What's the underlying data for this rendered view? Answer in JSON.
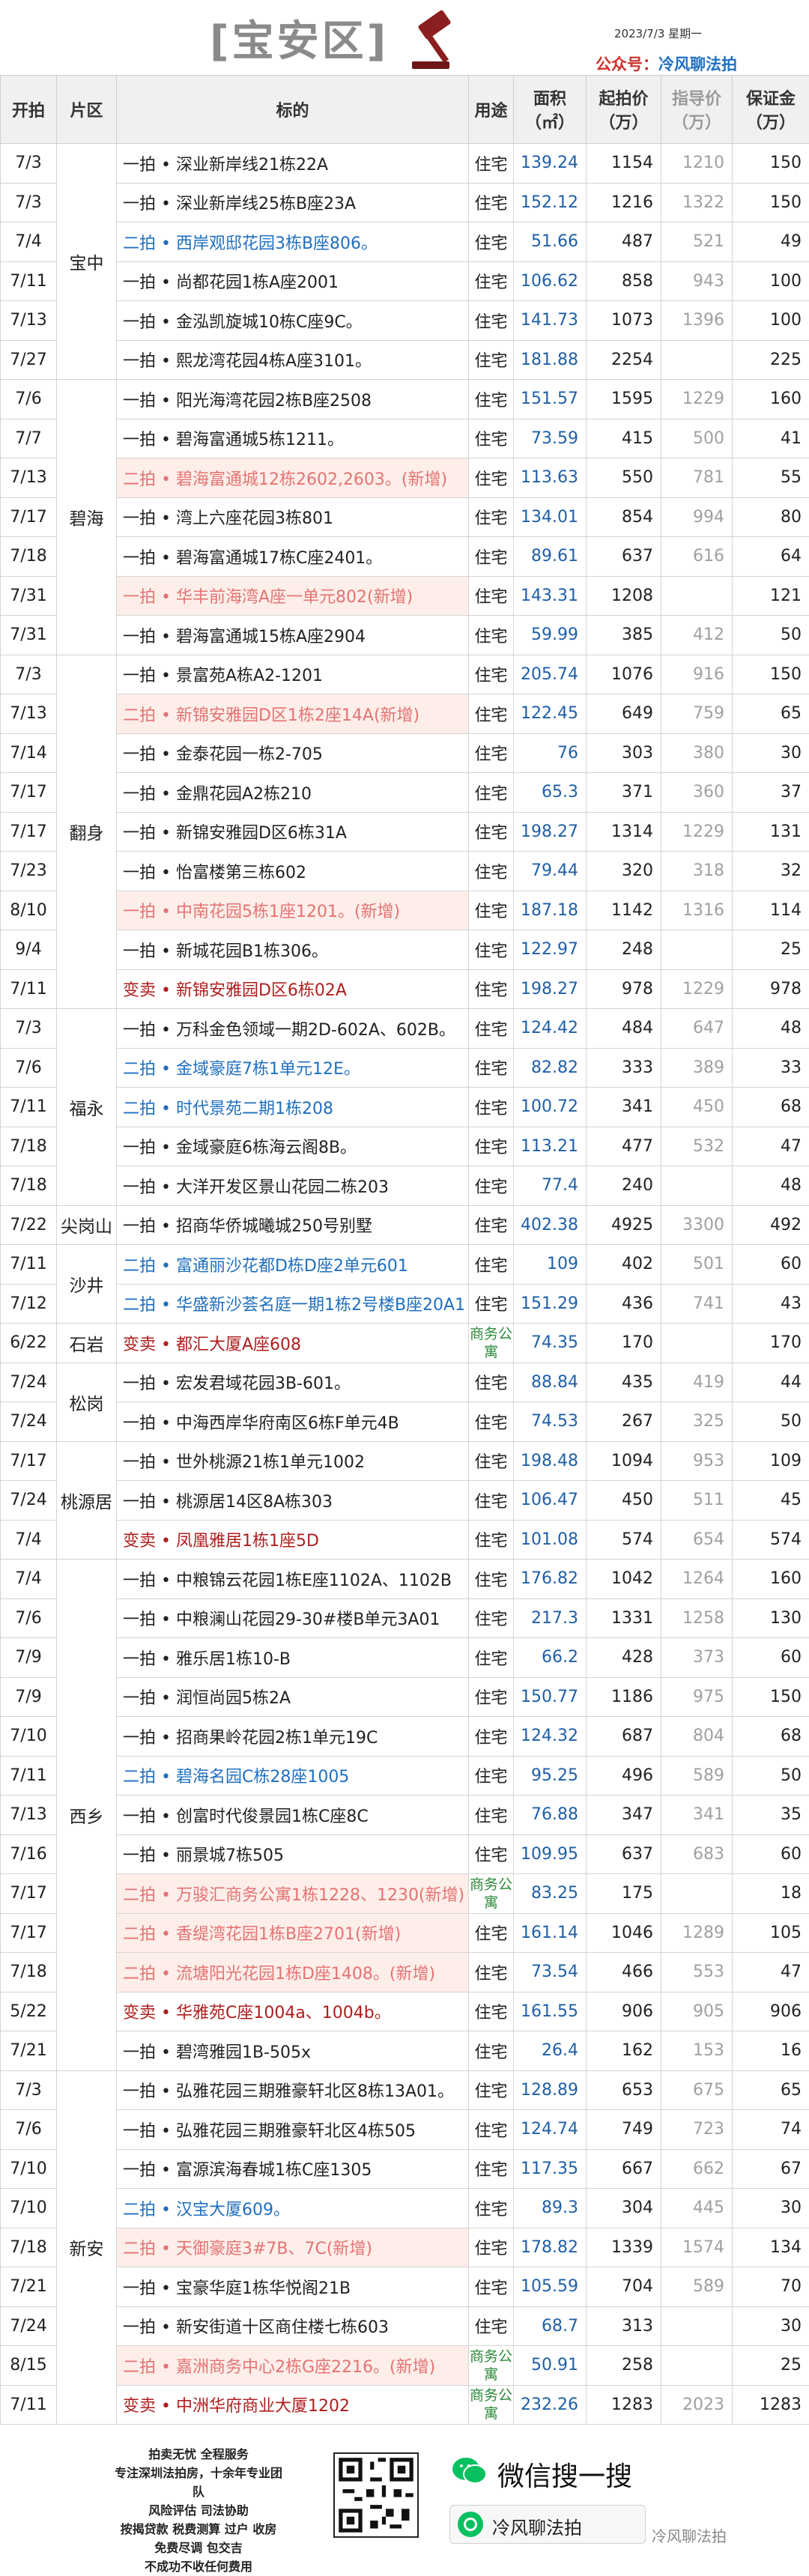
{
  "header": {
    "title": "[宝安区]",
    "date": "2023/7/3 星期一",
    "account_label": "公众号：",
    "account_name": "冷风聊法拍"
  },
  "columns": [
    "开拍",
    "片区",
    "标的",
    "用途",
    "面积（㎡）",
    "起拍价（万）",
    "指导价（万）",
    "保证金（万）"
  ],
  "colors": {
    "blue": "#1f6fc0",
    "red": "#b01e1e",
    "pink": "#e57373",
    "green": "#2e8b3a",
    "area": "#1f5fa8",
    "guide": "#a0a0a0"
  },
  "districts": [
    {
      "name": "宝中",
      "rows": [
        {
          "date": "7/3",
          "name": "一拍 • 深业新岸线21栋22A",
          "use": "住宅",
          "area": "139.24",
          "start": "1154",
          "guide": "1210",
          "deposit": "150",
          "style": ""
        },
        {
          "date": "7/3",
          "name": "一拍 • 深业新岸线25栋B座23A",
          "use": "住宅",
          "area": "152.12",
          "start": "1216",
          "guide": "1322",
          "deposit": "150",
          "style": ""
        },
        {
          "date": "7/4",
          "name": "二拍 • 西岸观邸花园3栋B座806。",
          "use": "住宅",
          "area": "51.66",
          "start": "487",
          "guide": "521",
          "deposit": "49",
          "style": "blue"
        },
        {
          "date": "7/11",
          "name": "一拍 • 尚都花园1栋A座2001",
          "use": "住宅",
          "area": "106.62",
          "start": "858",
          "guide": "943",
          "deposit": "100",
          "style": ""
        },
        {
          "date": "7/13",
          "name": "一拍 • 金泓凯旋城10栋C座9C。",
          "use": "住宅",
          "area": "141.73",
          "start": "1073",
          "guide": "1396",
          "deposit": "100",
          "style": ""
        },
        {
          "date": "7/27",
          "name": "一拍 • 熙龙湾花园4栋A座3101。",
          "use": "住宅",
          "area": "181.88",
          "start": "2254",
          "guide": "",
          "deposit": "225",
          "style": ""
        }
      ]
    },
    {
      "name": "碧海",
      "rows": [
        {
          "date": "7/6",
          "name": "一拍 • 阳光海湾花园2栋B座2508",
          "use": "住宅",
          "area": "151.57",
          "start": "1595",
          "guide": "1229",
          "deposit": "160",
          "style": ""
        },
        {
          "date": "7/7",
          "name": "一拍 • 碧海富通城5栋1211。",
          "use": "住宅",
          "area": "73.59",
          "start": "415",
          "guide": "500",
          "deposit": "41",
          "style": ""
        },
        {
          "date": "7/13",
          "name": "二拍 • 碧海富通城12栋2602,2603。(新增)",
          "use": "住宅",
          "area": "113.63",
          "start": "550",
          "guide": "781",
          "deposit": "55",
          "style": "pink"
        },
        {
          "date": "7/17",
          "name": "一拍 • 湾上六座花园3栋801",
          "use": "住宅",
          "area": "134.01",
          "start": "854",
          "guide": "994",
          "deposit": "80",
          "style": ""
        },
        {
          "date": "7/18",
          "name": "一拍 • 碧海富通城17栋C座2401。",
          "use": "住宅",
          "area": "89.61",
          "start": "637",
          "guide": "616",
          "deposit": "64",
          "style": ""
        },
        {
          "date": "7/31",
          "name": "一拍 • 华丰前海湾A座一单元802(新增)",
          "use": "住宅",
          "area": "143.31",
          "start": "1208",
          "guide": "",
          "deposit": "121",
          "style": "pink"
        },
        {
          "date": "7/31",
          "name": "一拍 • 碧海富通城15栋A座2904",
          "use": "住宅",
          "area": "59.99",
          "start": "385",
          "guide": "412",
          "deposit": "50",
          "style": ""
        }
      ]
    },
    {
      "name": "翻身",
      "rows": [
        {
          "date": "7/3",
          "name": "一拍 • 景富苑A栋A2-1201",
          "use": "住宅",
          "area": "205.74",
          "start": "1076",
          "guide": "916",
          "deposit": "150",
          "style": ""
        },
        {
          "date": "7/13",
          "name": "二拍 • 新锦安雅园D区1栋2座14A(新增)",
          "use": "住宅",
          "area": "122.45",
          "start": "649",
          "guide": "759",
          "deposit": "65",
          "style": "pink"
        },
        {
          "date": "7/14",
          "name": "一拍 • 金泰花园一栋2-705",
          "use": "住宅",
          "area": "76",
          "start": "303",
          "guide": "380",
          "deposit": "30",
          "style": ""
        },
        {
          "date": "7/17",
          "name": "一拍 • 金鼎花园A2栋210",
          "use": "住宅",
          "area": "65.3",
          "start": "371",
          "guide": "360",
          "deposit": "37",
          "style": ""
        },
        {
          "date": "7/17",
          "name": "一拍 • 新锦安雅园D区6栋31A",
          "use": "住宅",
          "area": "198.27",
          "start": "1314",
          "guide": "1229",
          "deposit": "131",
          "style": ""
        },
        {
          "date": "7/23",
          "name": "一拍 • 怡富楼第三栋602",
          "use": "住宅",
          "area": "79.44",
          "start": "320",
          "guide": "318",
          "deposit": "32",
          "style": ""
        },
        {
          "date": "8/10",
          "name": "一拍 • 中南花园5栋1座1201。(新增)",
          "use": "住宅",
          "area": "187.18",
          "start": "1142",
          "guide": "1316",
          "deposit": "114",
          "style": "pink"
        },
        {
          "date": "9/4",
          "name": "一拍 • 新城花园B1栋306。",
          "use": "住宅",
          "area": "122.97",
          "start": "248",
          "guide": "",
          "deposit": "25",
          "style": ""
        },
        {
          "date": "7/11",
          "name": "变卖 • 新锦安雅园D区6栋02A",
          "use": "住宅",
          "area": "198.27",
          "start": "978",
          "guide": "1229",
          "deposit": "978",
          "style": "red"
        }
      ]
    },
    {
      "name": "福永",
      "rows": [
        {
          "date": "7/3",
          "name": "一拍 • 万科金色领域一期2D-602A、602B。",
          "use": "住宅",
          "area": "124.42",
          "start": "484",
          "guide": "647",
          "deposit": "48",
          "style": ""
        },
        {
          "date": "7/6",
          "name": "二拍 • 金域豪庭7栋1单元12E。",
          "use": "住宅",
          "area": "82.82",
          "start": "333",
          "guide": "389",
          "deposit": "33",
          "style": "blue"
        },
        {
          "date": "7/11",
          "name": "二拍 • 时代景苑二期1栋208",
          "use": "住宅",
          "area": "100.72",
          "start": "341",
          "guide": "450",
          "deposit": "68",
          "style": "blue"
        },
        {
          "date": "7/18",
          "name": "一拍 • 金域豪庭6栋海云阁8B。",
          "use": "住宅",
          "area": "113.21",
          "start": "477",
          "guide": "532",
          "deposit": "47",
          "style": ""
        },
        {
          "date": "7/18",
          "name": "一拍 • 大洋开发区景山花园二栋203",
          "use": "住宅",
          "area": "77.4",
          "start": "240",
          "guide": "",
          "deposit": "48",
          "style": ""
        }
      ]
    },
    {
      "name": "尖岗山",
      "rows": [
        {
          "date": "7/22",
          "name": "一拍 • 招商华侨城曦城250号别墅",
          "use": "住宅",
          "area": "402.38",
          "start": "4925",
          "guide": "3300",
          "deposit": "492",
          "style": ""
        }
      ]
    },
    {
      "name": "沙井",
      "rows": [
        {
          "date": "7/11",
          "name": "二拍 • 富通丽沙花都D栋D座2单元601",
          "use": "住宅",
          "area": "109",
          "start": "402",
          "guide": "501",
          "deposit": "60",
          "style": "blue"
        },
        {
          "date": "7/12",
          "name": "二拍 • 华盛新沙荟名庭一期1栋2号楼B座20A1",
          "use": "住宅",
          "area": "151.29",
          "start": "436",
          "guide": "741",
          "deposit": "43",
          "style": "blue"
        }
      ]
    },
    {
      "name": "石岩",
      "rows": [
        {
          "date": "6/22",
          "name": "变卖 • 都汇大厦A座608",
          "use": "商务公寓",
          "area": "74.35",
          "start": "170",
          "guide": "",
          "deposit": "170",
          "style": "red"
        }
      ]
    },
    {
      "name": "松岗",
      "rows": [
        {
          "date": "7/24",
          "name": "一拍 • 宏发君域花园3B-601。",
          "use": "住宅",
          "area": "88.84",
          "start": "435",
          "guide": "419",
          "deposit": "44",
          "style": ""
        },
        {
          "date": "7/24",
          "name": "一拍 • 中海西岸华府南区6栋F单元4B",
          "use": "住宅",
          "area": "74.53",
          "start": "267",
          "guide": "325",
          "deposit": "50",
          "style": ""
        }
      ]
    },
    {
      "name": "桃源居",
      "rows": [
        {
          "date": "7/17",
          "name": "一拍 • 世外桃源21栋1单元1002",
          "use": "住宅",
          "area": "198.48",
          "start": "1094",
          "guide": "953",
          "deposit": "109",
          "style": ""
        },
        {
          "date": "7/24",
          "name": "一拍 • 桃源居14区8A栋303",
          "use": "住宅",
          "area": "106.47",
          "start": "450",
          "guide": "511",
          "deposit": "45",
          "style": ""
        },
        {
          "date": "7/4",
          "name": "变卖 • 凤凰雅居1栋1座5D",
          "use": "住宅",
          "area": "101.08",
          "start": "574",
          "guide": "654",
          "deposit": "574",
          "style": "red"
        }
      ]
    },
    {
      "name": "西乡",
      "rows": [
        {
          "date": "7/4",
          "name": "一拍 • 中粮锦云花园1栋E座1102A、1102B",
          "use": "住宅",
          "area": "176.82",
          "start": "1042",
          "guide": "1264",
          "deposit": "160",
          "style": ""
        },
        {
          "date": "7/6",
          "name": "一拍 • 中粮澜山花园29-30#楼B单元3A01",
          "use": "住宅",
          "area": "217.3",
          "start": "1331",
          "guide": "1258",
          "deposit": "130",
          "style": ""
        },
        {
          "date": "7/9",
          "name": "一拍 • 雅乐居1栋10-B",
          "use": "住宅",
          "area": "66.2",
          "start": "428",
          "guide": "373",
          "deposit": "60",
          "style": ""
        },
        {
          "date": "7/9",
          "name": "一拍 • 润恒尚园5栋2A",
          "use": "住宅",
          "area": "150.77",
          "start": "1186",
          "guide": "975",
          "deposit": "150",
          "style": ""
        },
        {
          "date": "7/10",
          "name": "一拍 • 招商果岭花园2栋1单元19C",
          "use": "住宅",
          "area": "124.32",
          "start": "687",
          "guide": "804",
          "deposit": "68",
          "style": ""
        },
        {
          "date": "7/11",
          "name": "二拍 • 碧海名园C栋28座1005",
          "use": "住宅",
          "area": "95.25",
          "start": "496",
          "guide": "589",
          "deposit": "50",
          "style": "blue"
        },
        {
          "date": "7/13",
          "name": "一拍 • 创富时代俊景园1栋C座8C",
          "use": "住宅",
          "area": "76.88",
          "start": "347",
          "guide": "341",
          "deposit": "35",
          "style": ""
        },
        {
          "date": "7/16",
          "name": "一拍 • 丽景城7栋505",
          "use": "住宅",
          "area": "109.95",
          "start": "637",
          "guide": "683",
          "deposit": "60",
          "style": ""
        },
        {
          "date": "7/17",
          "name": "二拍 • 万骏汇商务公寓1栋1228、1230(新增)",
          "use": "商务公寓",
          "area": "83.25",
          "start": "175",
          "guide": "",
          "deposit": "18",
          "style": "pink"
        },
        {
          "date": "7/17",
          "name": "二拍 • 香缇湾花园1栋B座2701(新增)",
          "use": "住宅",
          "area": "161.14",
          "start": "1046",
          "guide": "1289",
          "deposit": "105",
          "style": "pink"
        },
        {
          "date": "7/18",
          "name": "二拍 • 流塘阳光花园1栋D座1408。(新增)",
          "use": "住宅",
          "area": "73.54",
          "start": "466",
          "guide": "553",
          "deposit": "47",
          "style": "pink"
        },
        {
          "date": "5/22",
          "name": "变卖 • 华雅苑C座1004a、1004b。",
          "use": "住宅",
          "area": "161.55",
          "start": "906",
          "guide": "905",
          "deposit": "906",
          "style": "red"
        },
        {
          "date": "7/21",
          "name": "一拍 • 碧湾雅园1B-505x",
          "use": "住宅",
          "area": "26.4",
          "start": "162",
          "guide": "153",
          "deposit": "16",
          "style": ""
        }
      ]
    },
    {
      "name": "新安",
      "rows": [
        {
          "date": "7/3",
          "name": "一拍 • 弘雅花园三期雅豪轩北区8栋13A01。",
          "use": "住宅",
          "area": "128.89",
          "start": "653",
          "guide": "675",
          "deposit": "65",
          "style": ""
        },
        {
          "date": "7/6",
          "name": "一拍 • 弘雅花园三期雅豪轩北区4栋505",
          "use": "住宅",
          "area": "124.74",
          "start": "749",
          "guide": "723",
          "deposit": "74",
          "style": ""
        },
        {
          "date": "7/10",
          "name": "一拍 • 富源滨海春城1栋C座1305",
          "use": "住宅",
          "area": "117.35",
          "start": "667",
          "guide": "662",
          "deposit": "67",
          "style": ""
        },
        {
          "date": "7/10",
          "name": "二拍 • 汉宝大厦609。",
          "use": "住宅",
          "area": "89.3",
          "start": "304",
          "guide": "445",
          "deposit": "30",
          "style": "blue"
        },
        {
          "date": "7/18",
          "name": "二拍 • 天御豪庭3#7B、7C(新增)",
          "use": "住宅",
          "area": "178.82",
          "start": "1339",
          "guide": "1574",
          "deposit": "134",
          "style": "pink"
        },
        {
          "date": "7/21",
          "name": "一拍 • 宝豪华庭1栋华悦阁21B",
          "use": "住宅",
          "area": "105.59",
          "start": "704",
          "guide": "589",
          "deposit": "70",
          "style": ""
        },
        {
          "date": "7/24",
          "name": "一拍 • 新安街道十区商住楼七栋603",
          "use": "住宅",
          "area": "68.7",
          "start": "313",
          "guide": "",
          "deposit": "30",
          "style": ""
        },
        {
          "date": "8/15",
          "name": "二拍 • 嘉洲商务中心2栋G座2216。(新增)",
          "use": "商务公寓",
          "area": "50.91",
          "start": "258",
          "guide": "",
          "deposit": "25",
          "style": "pink"
        },
        {
          "date": "7/11",
          "name": "变卖 • 中洲华府商业大厦1202",
          "use": "商务公寓",
          "area": "232.26",
          "start": "1283",
          "guide": "2023",
          "deposit": "1283",
          "style": "red"
        }
      ]
    }
  ],
  "footer": {
    "lines": [
      "拍卖无忧 全程服务",
      "专注深圳法拍房，十余年专业团队",
      "风险评估 司法协助",
      "按揭贷款 税费测算 过户 收房",
      "免费尽调 包交吉",
      "不成功不收任何费用"
    ],
    "search_label": "微信搜一搜",
    "search_term": "冷风聊法拍",
    "watermark": "冷风聊法拍"
  }
}
